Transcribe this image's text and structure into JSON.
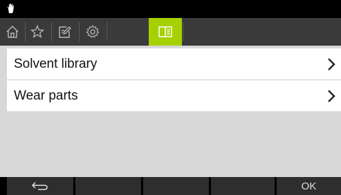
{
  "status": {
    "icon": "hand-icon"
  },
  "tabs": [
    {
      "icon": "home-icon",
      "active": false
    },
    {
      "icon": "star-icon",
      "active": false
    },
    {
      "icon": "edit-icon",
      "active": false
    },
    {
      "icon": "gear-icon",
      "active": false
    },
    {
      "icon": "book-icon",
      "active": true
    }
  ],
  "menu": {
    "items": [
      {
        "label": "Solvent library"
      },
      {
        "label": "Wear parts"
      }
    ]
  },
  "softkeys": {
    "back_icon": "back-arrow-icon",
    "ok_label": "OK"
  },
  "colors": {
    "accent": "#a6d000",
    "tabbar": "#3a3a3a",
    "content_bg": "#d8d8d8"
  }
}
